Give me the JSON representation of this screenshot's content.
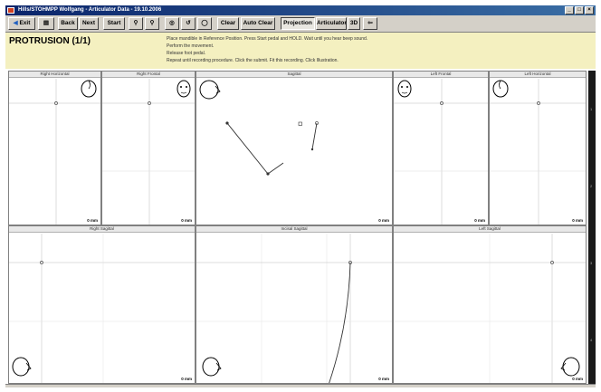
{
  "window": {
    "title": "Hills/STOHMPP Wolfgang - Articulator Data - 19.10.2006",
    "controls": [
      "_",
      "□",
      "×"
    ]
  },
  "toolbar": {
    "exit_label": "Exit",
    "print_icon": "print-icon",
    "back_label": "Back",
    "next_label": "Next",
    "start_label": "Start",
    "clear_label": "Clear",
    "auto_clear_label": "Auto Clear",
    "projection_label": "Projection",
    "articulator_label": "Articulator",
    "threed_label": "3D",
    "arrow_icon": "arrow-left-icon"
  },
  "header": {
    "title": "PROTRUSION (1/1)",
    "instructions": [
      "Place mandible in Reference Position. Press Start pedal and HOLD. Wait until you hear beep sound.",
      "Perform the movement.",
      "Release foot pedal.",
      "Repeat until recording procedure. Click the submit. Fit this recording. Click Illustration."
    ]
  },
  "panels": {
    "right_horizontal": {
      "title": "Right Horizontal",
      "scale": "0 mm"
    },
    "right_frontal": {
      "title": "Right Frontal",
      "scale": "0 mm"
    },
    "sagittal": {
      "title": "Sagittal",
      "scale": "0 mm"
    },
    "left_frontal": {
      "title": "Left Frontal",
      "scale": "0 mm"
    },
    "left_horizontal": {
      "title": "Left Horizontal",
      "scale": "0 mm"
    },
    "right_sagittal": {
      "title": "Right Sagittal",
      "scale": "0 mm"
    },
    "incisal_sagittal": {
      "title": "Incisal Sagittal",
      "scale": "0 mm"
    },
    "left_sagittal": {
      "title": "Left Sagittal",
      "scale": "0 mm"
    }
  },
  "rightbar": {
    "marks": [
      "1",
      "2",
      "3",
      "4"
    ]
  }
}
